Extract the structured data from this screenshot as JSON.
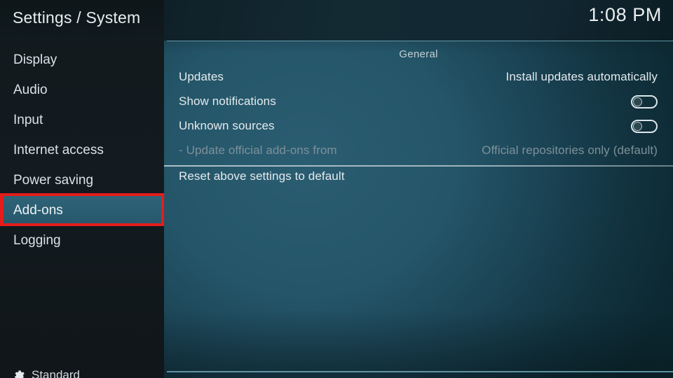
{
  "header": {
    "title": "Settings / System",
    "clock": "1:08 PM"
  },
  "sidebar": {
    "items": [
      {
        "label": "Display",
        "name": "sidebar-item-display",
        "selected": false
      },
      {
        "label": "Audio",
        "name": "sidebar-item-audio",
        "selected": false
      },
      {
        "label": "Input",
        "name": "sidebar-item-input",
        "selected": false
      },
      {
        "label": "Internet access",
        "name": "sidebar-item-internet-access",
        "selected": false
      },
      {
        "label": "Power saving",
        "name": "sidebar-item-power-saving",
        "selected": false
      },
      {
        "label": "Add-ons",
        "name": "sidebar-item-add-ons",
        "selected": true
      },
      {
        "label": "Logging",
        "name": "sidebar-item-logging",
        "selected": false
      }
    ],
    "settings_level": {
      "label": "Standard",
      "icon": "gear-icon"
    }
  },
  "main": {
    "group_header": "General",
    "rows": [
      {
        "label": "Updates",
        "type": "value",
        "value": "Install updates automatically",
        "disabled": false,
        "name": "setting-row-updates"
      },
      {
        "label": "Show notifications",
        "type": "toggle",
        "value": "off",
        "disabled": false,
        "name": "setting-row-show-notifications"
      },
      {
        "label": "Unknown sources",
        "type": "toggle",
        "value": "off",
        "disabled": false,
        "name": "setting-row-unknown-sources"
      },
      {
        "label": "- Update official add-ons from",
        "type": "value",
        "value": "Official repositories only (default)",
        "disabled": true,
        "name": "setting-row-update-official-add-ons-from"
      },
      {
        "label": "Reset above settings to default",
        "type": "action",
        "value": "",
        "disabled": false,
        "name": "setting-row-reset-above-settings-to-default"
      }
    ]
  },
  "annotation": {
    "target": "Add-ons",
    "color": "#e51c1c"
  },
  "colors": {
    "sidebar_bg": "#121a1e",
    "panel_accent": "#2b5d72",
    "rule": "#6fa9ba",
    "text": "#e4ebee",
    "text_disabled": "#7d9099",
    "highlight": "#e51c1c"
  }
}
